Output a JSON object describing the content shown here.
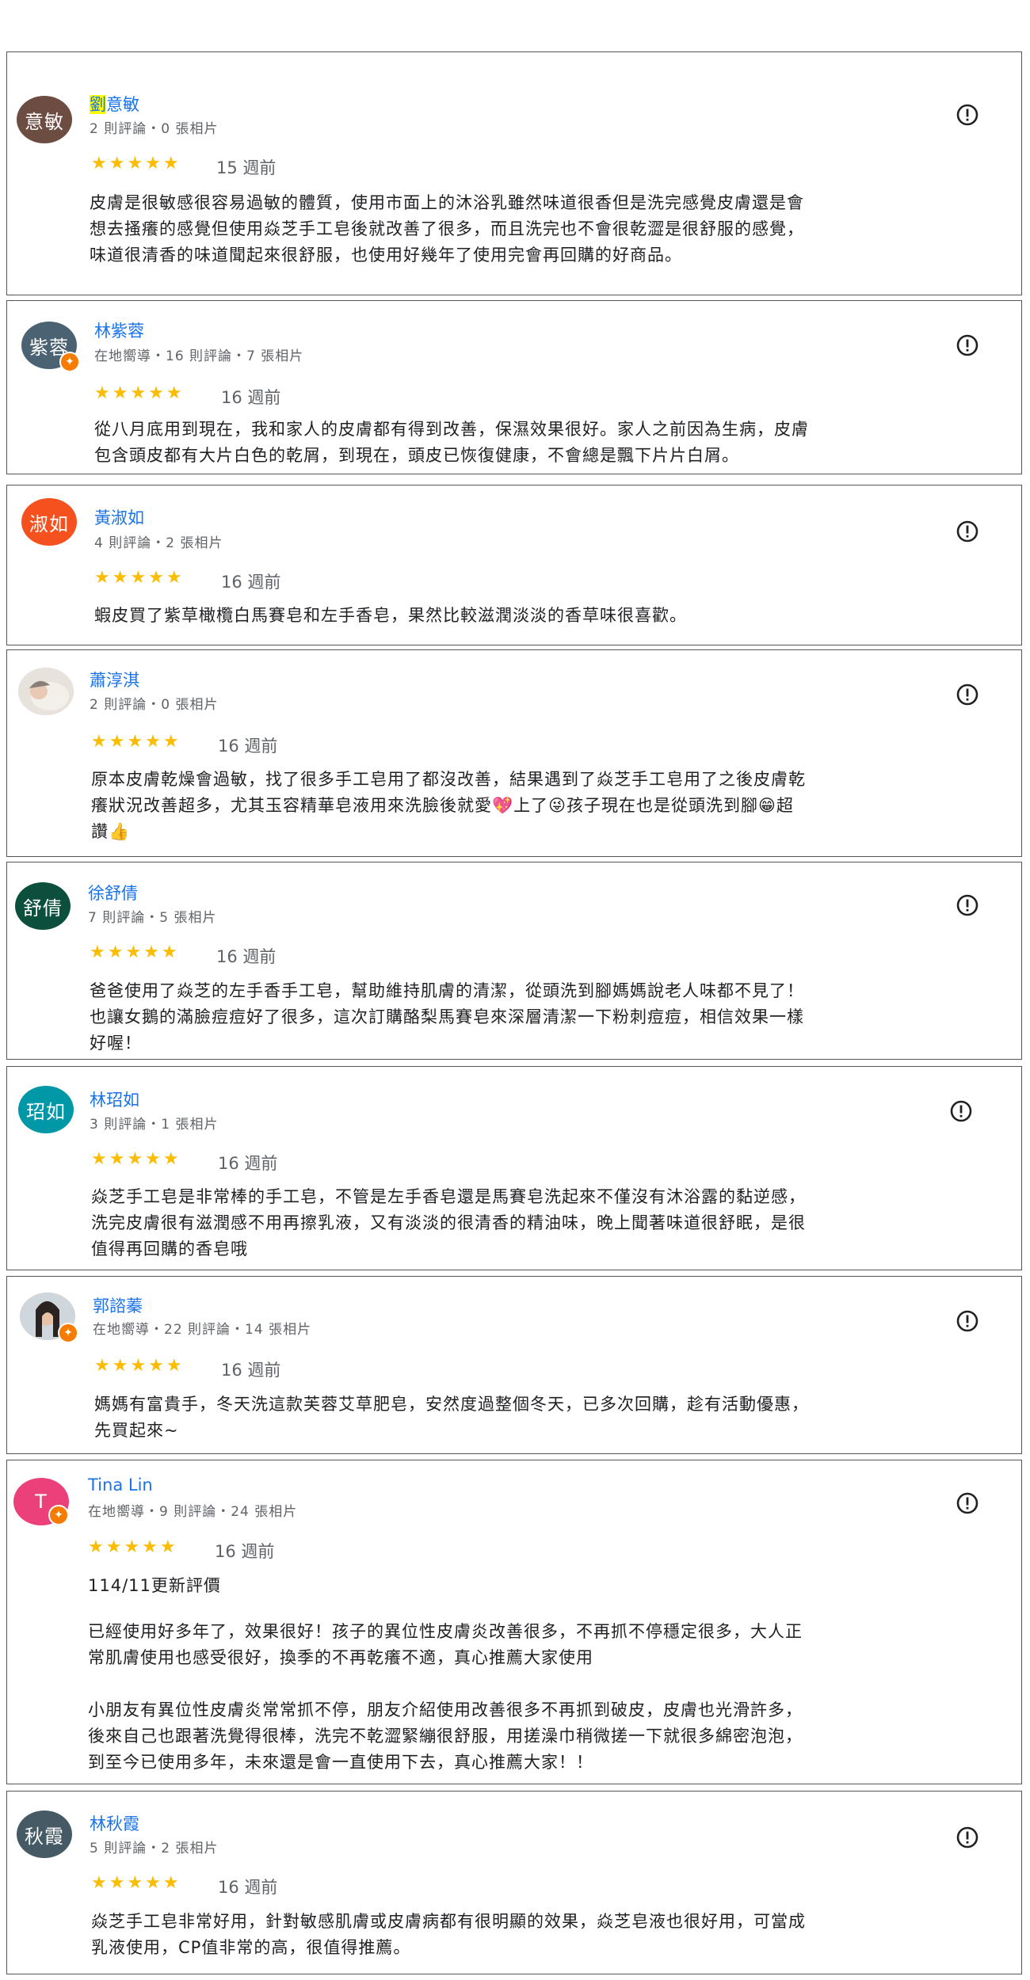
{
  "colors": {
    "name_link": "#1a73e8",
    "star": "#fbbc04",
    "local_guide_badge": "#f57c00"
  },
  "icons": {
    "report": "report-flag-icon",
    "star": "star-icon",
    "local_guide": "local-guide-badge-icon"
  },
  "reviews": [
    {
      "avatar_text": "意敏",
      "avatar_color": "#6d4c41",
      "name_highlight": "劉",
      "name_rest": "意敏",
      "meta": "2 則評論・0 張相片",
      "rating": 5,
      "stars": "★★★★★",
      "time": "15 週前",
      "text": "皮膚是很敏感很容易過敏的體質，使用市面上的沐浴乳雖然味道很香但是洗完感覺皮膚還是會\n想去搔癢的感覺但使用焱芝手工皂後就改善了很多，而且洗完也不會很乾澀是很舒服的感覺，\n味道很清香的味道聞起來很舒服，也使用好幾年了使用完會再回購的好商品。"
    },
    {
      "avatar_text": "紫蓉",
      "avatar_color": "#4a6272",
      "local_guide": true,
      "name": "林紫蓉",
      "meta": "在地嚮導・16 則評論・7 張相片",
      "rating": 5,
      "stars": "★★★★★",
      "time": "16 週前",
      "text": "從八月底用到現在，我和家人的皮膚都有得到改善，保濕效果很好。家人之前因為生病，皮膚\n包含頭皮都有大片白色的乾屑，到現在，頭皮已恢復健康，不會總是飄下片片白屑。"
    },
    {
      "avatar_text": "淑如",
      "avatar_color": "#f4511e",
      "name": "黃淑如",
      "meta": "4 則評論・2 張相片",
      "rating": 5,
      "stars": "★★★★★",
      "time": "16 週前",
      "text": "蝦皮買了紫草橄欖白馬賽皂和左手香皂，果然比較滋潤淡淡的香草味很喜歡。"
    },
    {
      "avatar_photo": true,
      "name": "蕭淳淇",
      "meta": "2 則評論・0 張相片",
      "rating": 5,
      "stars": "★★★★★",
      "time": "16 週前",
      "text": "原本皮膚乾燥會過敏，找了很多手工皂用了都沒改善，結果遇到了焱芝手工皂用了之後皮膚乾\n癢狀況改善超多，尤其玉容精華皂液用來洗臉後就愛💖上了😜孩子現在也是從頭洗到腳😁超\n讚👍"
    },
    {
      "avatar_text": "舒倩",
      "avatar_color": "#0b4f3c",
      "name": "徐舒倩",
      "meta": "7 則評論・5 張相片",
      "rating": 5,
      "stars": "★★★★★",
      "time": "16 週前",
      "text": "爸爸使用了焱芝的左手香手工皂，幫助維持肌膚的清潔，從頭洗到腳媽媽說老人味都不見了！\n也讓女鵝的滿臉痘痘好了很多，這次訂購酪梨馬賽皂來深層清潔一下粉刺痘痘，相信效果一樣\n好喔！"
    },
    {
      "avatar_text": "玿如",
      "avatar_color": "#0097a7",
      "name": "林玿如",
      "meta": "3 則評論・1 張相片",
      "rating": 5,
      "stars": "★★★★★",
      "time": "16 週前",
      "text": "焱芝手工皂是非常棒的手工皂，不管是左手香皂還是馬賽皂洗起來不僅沒有沐浴露的黏逆感，\n洗完皮膚很有滋潤感不用再擦乳液，又有淡淡的很清香的精油味，晚上聞著味道很舒眠，是很\n值得再回購的香皂哦"
    },
    {
      "avatar_photo": true,
      "local_guide": true,
      "name": "郭諮蓁",
      "meta": "在地嚮導・22 則評論・14 張相片",
      "rating": 5,
      "stars": "★★★★★",
      "time": "16 週前",
      "text": "媽媽有富貴手，冬天洗這款芙蓉艾草肥皂，安然度過整個冬天，已多次回購，趁有活動優惠，\n先買起來~"
    },
    {
      "avatar_text": "T",
      "avatar_color": "#ec407a",
      "local_guide": true,
      "name": "Tina Lin",
      "meta": "在地嚮導・9 則評論・24 張相片",
      "rating": 5,
      "stars": "★★★★★",
      "time": "16 週前",
      "updated": "114/11更新評價",
      "text": "已經使用好多年了，效果很好！孩子的異位性皮膚炎改善很多，不再抓不停穩定很多，大人正\n常肌膚使用也感受很好，換季的不再乾癢不適，真心推薦大家使用\n\n小朋友有異位性皮膚炎常常抓不停，朋友介紹使用改善很多不再抓到破皮，皮膚也光滑許多，\n後來自己也跟著洗覺得很棒，洗完不乾澀緊繃很舒服，用搓澡巾稍微搓一下就很多綿密泡泡，\n到至今已使用多年，未來還是會一直使用下去，真心推薦大家！！"
    },
    {
      "avatar_text": "秋霞",
      "avatar_color": "#455a64",
      "name": "林秋霞",
      "meta": "5 則評論・2 張相片",
      "rating": 5,
      "stars": "★★★★★",
      "time": "16 週前",
      "text": "焱芝手工皂非常好用，針對敏感肌膚或皮膚病都有很明顯的效果，焱芝皂液也很好用，可當成\n乳液使用，CP值非常的高，很值得推薦。"
    }
  ]
}
